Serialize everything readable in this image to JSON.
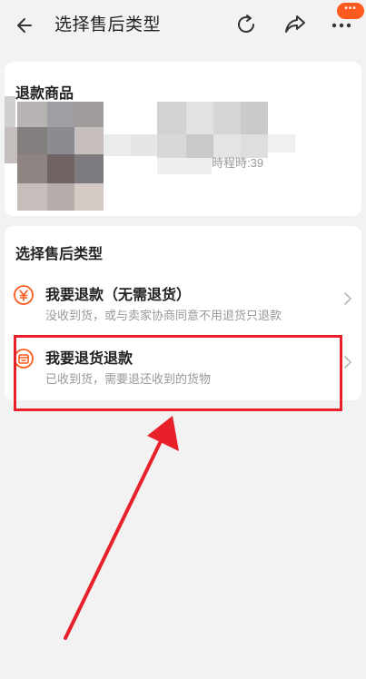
{
  "header": {
    "title": "选择售后类型",
    "badge": "•••"
  },
  "product_card": {
    "section_title": "退款商品",
    "time_fragment": "時程時:39"
  },
  "type_card": {
    "section_title": "选择售后类型",
    "options": [
      {
        "title": "我要退款（无需退货）",
        "desc": "没收到货，或与卖家协商同意不用退货只退款",
        "icon": "yen-circle-icon"
      },
      {
        "title": "我要退货退款",
        "desc": "已收到货，需要退还收到的货物",
        "icon": "return-box-icon"
      }
    ]
  },
  "colors": {
    "accent": "#ff5a1f",
    "annotation": "#e8202a",
    "background": "#f2f2f2"
  }
}
